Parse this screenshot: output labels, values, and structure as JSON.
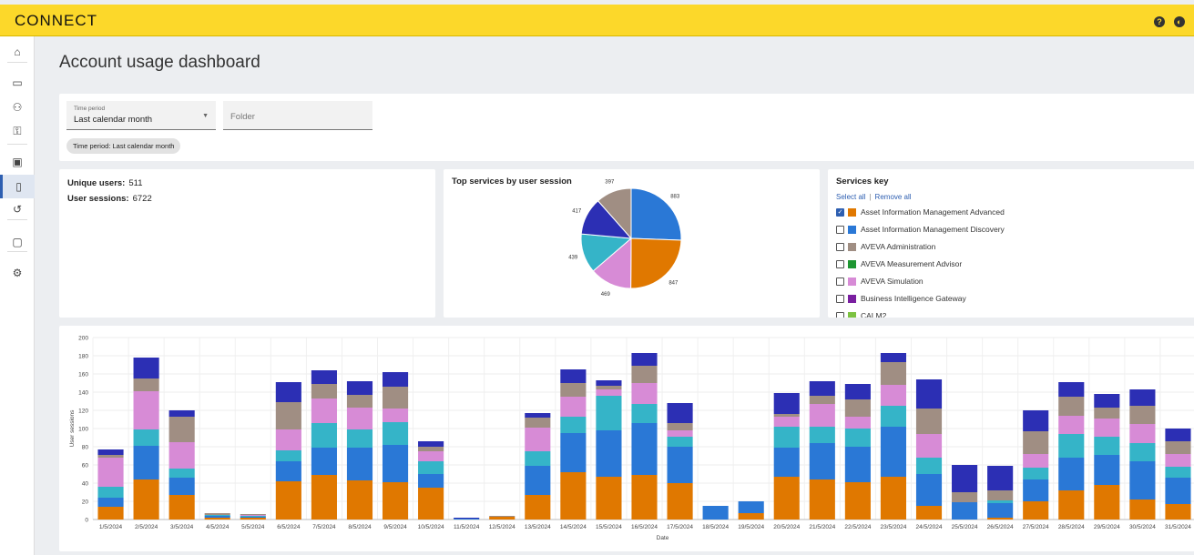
{
  "app": {
    "logo": "CONNECT"
  },
  "topbar_icons": [
    "help-icon",
    "account-icon"
  ],
  "sidebar": {
    "items": [
      {
        "name": "home-icon",
        "glyph": "⌂"
      },
      {
        "name": "folder-icon",
        "glyph": "▭"
      },
      {
        "name": "users-settings-icon",
        "glyph": "⚇"
      },
      {
        "name": "key-icon",
        "glyph": "⚿"
      },
      {
        "name": "dashboard-icon",
        "glyph": "▣"
      },
      {
        "name": "document-icon",
        "glyph": "▯",
        "active": true
      },
      {
        "name": "history-icon",
        "glyph": "↺"
      },
      {
        "name": "trash-icon",
        "glyph": "▢"
      },
      {
        "name": "settings-icon",
        "glyph": "⚙"
      }
    ]
  },
  "page": {
    "title": "Account usage dashboard"
  },
  "filters": {
    "time_period": {
      "label": "Time period",
      "value": "Last calendar month"
    },
    "folder": {
      "placeholder": "Folder"
    },
    "chip": "Time period: Last calendar month"
  },
  "summary": {
    "unique_users_label": "Unique users:",
    "unique_users_value": "511",
    "user_sessions_label": "User sessions:",
    "user_sessions_value": "6722"
  },
  "pie": {
    "title": "Top services by user session",
    "slices": [
      {
        "value": 883,
        "label": "883",
        "color": "#2a78d6"
      },
      {
        "value": 847,
        "label": "847",
        "color": "#e07800"
      },
      {
        "value": 469,
        "label": "469",
        "color": "#d78bd6"
      },
      {
        "value": 439,
        "label": "439",
        "color": "#35b4c8"
      },
      {
        "value": 417,
        "label": "417",
        "color": "#2c2fb4"
      },
      {
        "value": 397,
        "label": "397",
        "color": "#a08e83"
      }
    ]
  },
  "services_key": {
    "title": "Services key",
    "select_all": "Select all",
    "separator": "|",
    "remove_all": "Remove all",
    "items": [
      {
        "label": "Asset Information Management Advanced",
        "color": "#e07800",
        "checked": true
      },
      {
        "label": "Asset Information Management Discovery",
        "color": "#2a78d6",
        "checked": false
      },
      {
        "label": "AVEVA Administration",
        "color": "#a08e83",
        "checked": false
      },
      {
        "label": "AVEVA Measurement Advisor",
        "color": "#1e9632",
        "checked": false
      },
      {
        "label": "AVEVA Simulation",
        "color": "#d78bd6",
        "checked": false
      },
      {
        "label": "Business Intelligence Gateway",
        "color": "#7a1fa0",
        "checked": false
      },
      {
        "label": "CALM2",
        "color": "#7cc241",
        "checked": false
      }
    ]
  },
  "chart_data": {
    "type": "bar",
    "stacked": true,
    "xlabel": "Date",
    "ylabel": "User sessions",
    "ylim": [
      0,
      200
    ],
    "yticks": [
      0,
      20,
      40,
      60,
      80,
      100,
      120,
      140,
      160,
      180,
      200
    ],
    "categories": [
      "1/5/2024",
      "2/5/2024",
      "3/5/2024",
      "4/5/2024",
      "5/5/2024",
      "6/5/2024",
      "7/5/2024",
      "8/5/2024",
      "9/5/2024",
      "10/5/2024",
      "11/5/2024",
      "12/5/2024",
      "13/5/2024",
      "14/5/2024",
      "15/5/2024",
      "16/5/2024",
      "17/5/2024",
      "18/5/2024",
      "19/5/2024",
      "20/5/2024",
      "21/5/2024",
      "22/5/2024",
      "23/5/2024",
      "24/5/2024",
      "25/5/2024",
      "26/5/2024",
      "27/5/2024",
      "28/5/2024",
      "29/5/2024",
      "30/5/2024",
      "31/5/2024"
    ],
    "series": [
      {
        "color": "#e07800",
        "values": [
          14,
          44,
          27,
          2,
          2,
          42,
          49,
          43,
          41,
          35,
          0,
          3,
          27,
          52,
          47,
          49,
          40,
          0,
          7,
          47,
          44,
          41,
          47,
          15,
          0,
          2,
          20,
          32,
          38,
          22,
          17
        ]
      },
      {
        "color": "#2a78d6",
        "values": [
          10,
          37,
          19,
          2,
          1,
          22,
          30,
          36,
          41,
          15,
          1,
          0,
          32,
          43,
          51,
          57,
          40,
          15,
          13,
          32,
          40,
          39,
          55,
          35,
          19,
          16,
          24,
          36,
          33,
          42,
          29
        ]
      },
      {
        "color": "#35b4c8",
        "values": [
          12,
          18,
          10,
          1,
          1,
          12,
          27,
          20,
          25,
          14,
          0,
          0,
          16,
          18,
          38,
          21,
          11,
          0,
          0,
          23,
          18,
          20,
          23,
          18,
          0,
          3,
          13,
          26,
          20,
          20,
          12
        ]
      },
      {
        "color": "#d78bd6",
        "values": [
          32,
          42,
          29,
          0,
          1,
          23,
          27,
          24,
          15,
          11,
          0,
          0,
          26,
          22,
          7,
          23,
          7,
          0,
          0,
          11,
          25,
          13,
          23,
          26,
          0,
          0,
          15,
          20,
          20,
          21,
          14
        ]
      },
      {
        "color": "#a08e83",
        "values": [
          3,
          14,
          28,
          2,
          1,
          30,
          16,
          14,
          24,
          5,
          0,
          1,
          11,
          15,
          4,
          19,
          8,
          0,
          0,
          3,
          9,
          19,
          25,
          28,
          11,
          11,
          25,
          21,
          12,
          20,
          14
        ]
      },
      {
        "color": "#2c2fb4",
        "values": [
          6,
          23,
          7,
          0,
          0,
          22,
          15,
          15,
          16,
          6,
          1,
          0,
          5,
          15,
          6,
          14,
          22,
          0,
          0,
          23,
          16,
          17,
          10,
          32,
          30,
          27,
          23,
          16,
          15,
          18,
          14
        ]
      }
    ]
  }
}
